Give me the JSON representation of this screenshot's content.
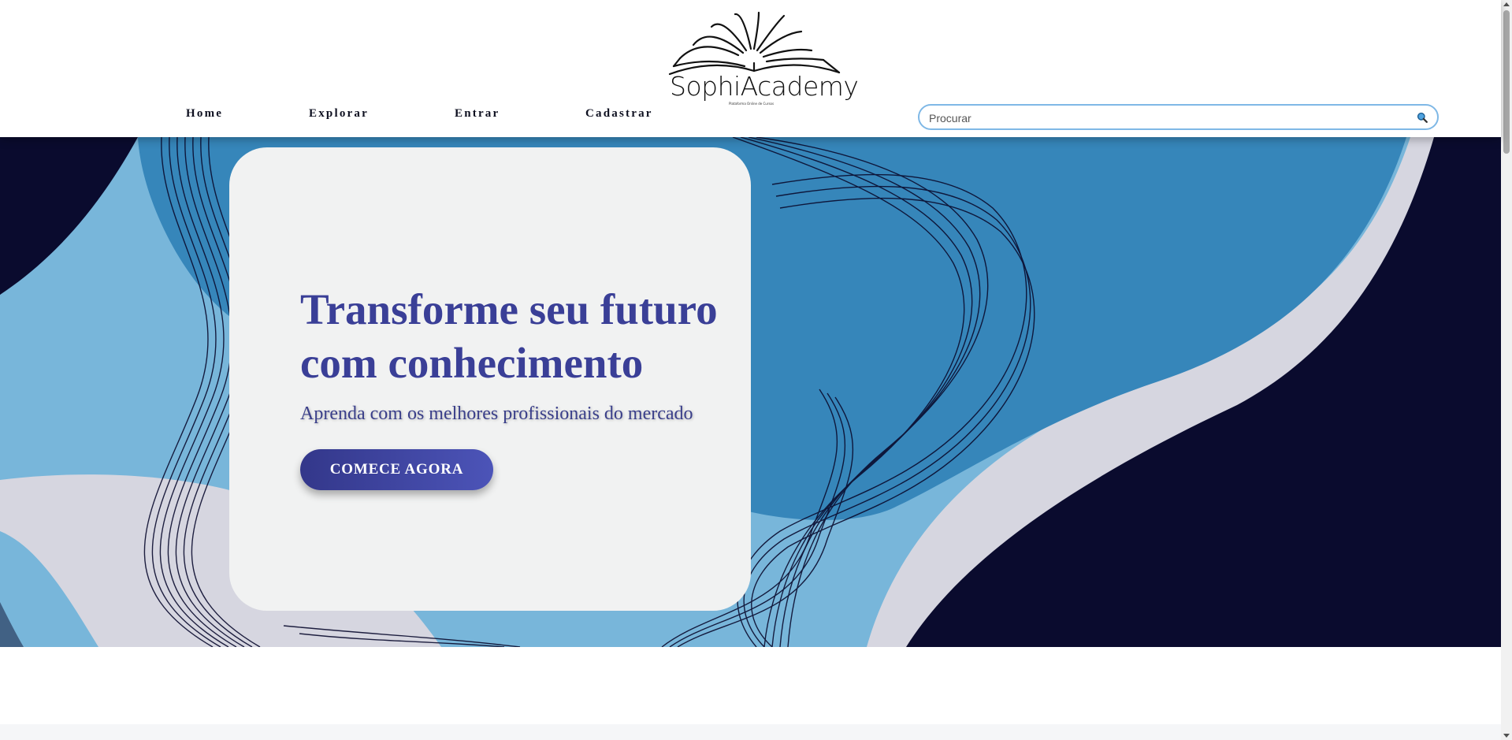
{
  "brand": {
    "name": "SophiAcademy",
    "tagline": "Plataforma Online de Cursos"
  },
  "nav": {
    "items": [
      {
        "label": "Home"
      },
      {
        "label": "Explorar"
      },
      {
        "label": "Entrar"
      },
      {
        "label": "Cadastrar"
      }
    ]
  },
  "search": {
    "placeholder": "Procurar",
    "value": "",
    "icon": "magnifier-icon"
  },
  "hero": {
    "title": "Transforme seu futuro com conhecimento",
    "subtitle": "Aprenda com os melhores profissionais do mercado",
    "cta_label": "COMECE AGORA"
  },
  "colors": {
    "accent": "#3a3f97",
    "navy": "#0a0b2e",
    "sky_blue": "#3686ba",
    "light_blue": "#78b6da",
    "lavender_gray": "#d6d6e0",
    "card_bg": "#f1f2f2"
  }
}
